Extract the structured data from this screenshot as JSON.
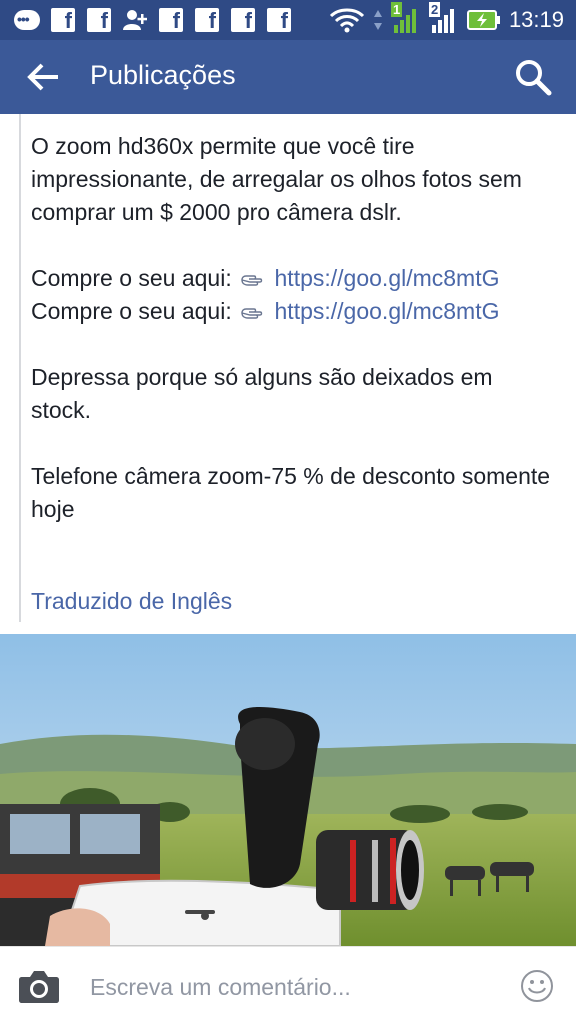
{
  "status_bar": {
    "time": "13:19",
    "sim1_label": "1",
    "sim2_label": "2"
  },
  "app_bar": {
    "title": "Publicações"
  },
  "post": {
    "paragraphs": [
      "O zoom hd360x permite que você tire impressionante, de arregalar os olhos fotos sem comprar um $ 2000 pro câmera dslr."
    ],
    "buy_label": "Compre o seu aqui:",
    "link": "https://goo.gl/mc8mtG",
    "hurry": "Depressa porque só alguns são deixados em stock.",
    "promo": "Telefone câmera zoom-75 % de desconto somente hoje",
    "translated": "Traduzido de Inglês"
  },
  "comment_bar": {
    "placeholder": "Escreva um comentário..."
  }
}
